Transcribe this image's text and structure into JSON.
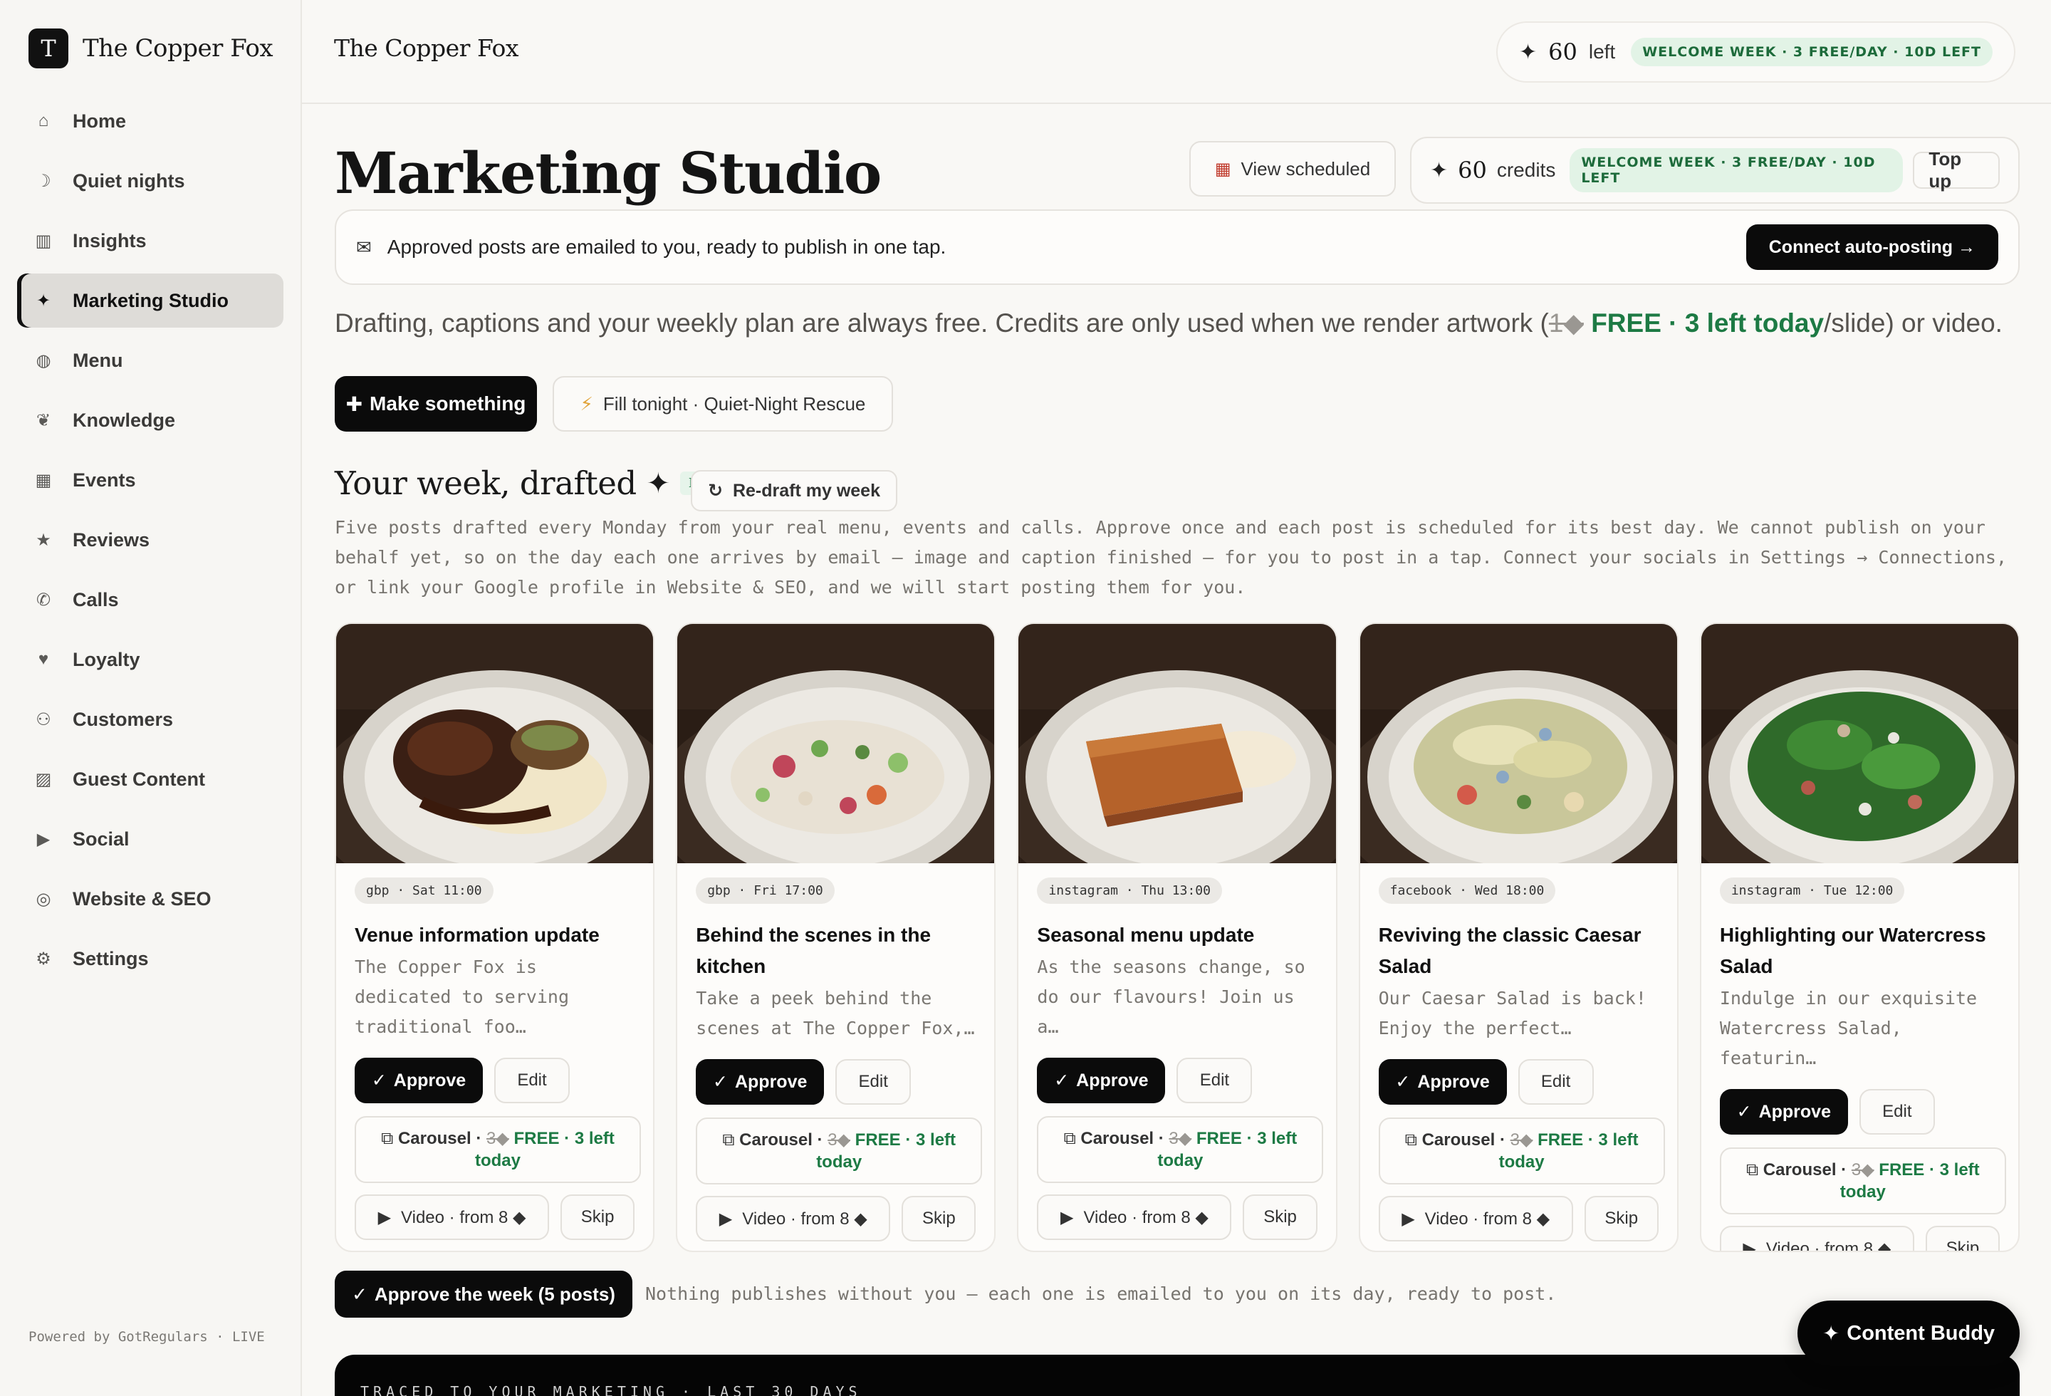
{
  "brand": {
    "mark": "T",
    "name": "The Copper Fox"
  },
  "sidebar": {
    "items": [
      {
        "label": "Home",
        "icon": "home-icon",
        "glyph": "⌂"
      },
      {
        "label": "Quiet nights",
        "icon": "moon-icon",
        "glyph": "☽"
      },
      {
        "label": "Insights",
        "icon": "bar-chart-icon",
        "glyph": "▥"
      },
      {
        "label": "Marketing Studio",
        "icon": "sparkle-icon",
        "glyph": "✦"
      },
      {
        "label": "Menu",
        "icon": "plate-icon",
        "glyph": "◍"
      },
      {
        "label": "Knowledge",
        "icon": "brain-icon",
        "glyph": "❦"
      },
      {
        "label": "Events",
        "icon": "calendar-icon",
        "glyph": "▦"
      },
      {
        "label": "Reviews",
        "icon": "star-icon",
        "glyph": "★"
      },
      {
        "label": "Calls",
        "icon": "phone-icon",
        "glyph": "✆"
      },
      {
        "label": "Loyalty",
        "icon": "heart-icon",
        "glyph": "♥"
      },
      {
        "label": "Customers",
        "icon": "users-icon",
        "glyph": "⚇"
      },
      {
        "label": "Guest Content",
        "icon": "clapper-icon",
        "glyph": "▨"
      },
      {
        "label": "Social",
        "icon": "play-icon",
        "glyph": "▶"
      },
      {
        "label": "Website & SEO",
        "icon": "globe-icon",
        "glyph": "◎"
      },
      {
        "label": "Settings",
        "icon": "gear-icon",
        "glyph": "⚙"
      }
    ],
    "active": "Marketing Studio",
    "powered": "Powered by GotRegulars · LIVE"
  },
  "topbar": {
    "title": "The Copper Fox",
    "credits_count": "60",
    "credits_word": "left",
    "badge": "WELCOME WEEK · 3 FREE/DAY · 10D LEFT"
  },
  "header": {
    "title": "Marketing Studio",
    "view_scheduled": "View scheduled",
    "credits_count": "60",
    "credits_word": "credits",
    "badge": "WELCOME WEEK · 3 FREE/DAY · 10D LEFT",
    "top_up": "Top up"
  },
  "notice": {
    "text": "Approved posts are emailed to you, ready to publish in one tap.",
    "button": "Connect auto-posting →"
  },
  "free_line": {
    "before": "Drafting, captions and your weekly plan are always free. Credits are only used when we render artwork (",
    "strike": "1◆",
    "green": " FREE · 3 left today",
    "after": "/slide) or video."
  },
  "actions": {
    "make": "Make something",
    "fill": "Fill tonight · Quiet-Night Rescue"
  },
  "week": {
    "title": "Your week, drafted",
    "free_badge": "FREE",
    "redraft": "Re-draft my week",
    "description": "Five posts drafted every Monday from your real menu, events and calls. Approve once and each post is scheduled for its best day. We cannot publish on your behalf yet, so on the day each one arrives by email — image and caption finished — for you to post in a tap. Connect your socials in Settings → Connections, or link your Google profile in Website & SEO, and we will start posting them for you."
  },
  "cards": [
    {
      "tag": "gbp · Sat 11:00",
      "title": "Venue information update",
      "text": "The Copper Fox is dedicated to serving traditional foo…",
      "dish": "braised-beef"
    },
    {
      "tag": "gbp · Fri 17:00",
      "title": "Behind the scenes in the kitchen",
      "text": "Take a peek behind the scenes at The Copper Fox,…",
      "dish": "crab-salad"
    },
    {
      "tag": "instagram · Thu 13:00",
      "title": "Seasonal menu update",
      "text": "As the seasons change, so do our flavours! Join us a…",
      "dish": "sponge-pudding"
    },
    {
      "tag": "facebook · Wed 18:00",
      "title": "Reviving the classic Caesar Salad",
      "text": "Our Caesar Salad is back! Enjoy the perfect…",
      "dish": "caesar-salad"
    },
    {
      "tag": "instagram · Tue 12:00",
      "title": "Highlighting our Watercress Salad",
      "text": "Indulge in our exquisite Watercress Salad, featurin…",
      "dish": "watercress-salad"
    }
  ],
  "card_labels": {
    "approve": "Approve",
    "edit": "Edit",
    "carousel": "Carousel · ",
    "carousel_strike": "3◆",
    "carousel_green": " FREE · 3 left today",
    "video": "Video · from 8 ◆",
    "skip": "Skip"
  },
  "footer": {
    "approve_week": "Approve the week (5 posts)",
    "note": "Nothing publishes without you — each one is emailed to you on its day, ready to post.",
    "traced": "TRACED TO YOUR MARKETING · LAST 30 DAYS",
    "buddy": "Content Buddy"
  },
  "colors": {
    "accent_green": "#1d7a44",
    "badge_bg": "#e2f3e6",
    "primary_button": "#0b0b0b"
  }
}
